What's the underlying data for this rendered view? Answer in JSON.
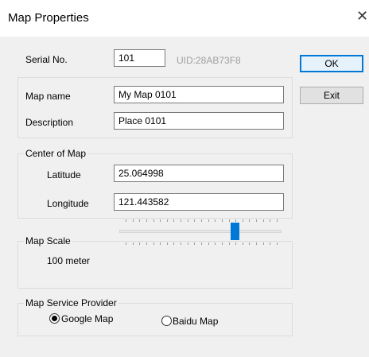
{
  "window": {
    "title": "Map Properties",
    "close_glyph": "✕"
  },
  "serial": {
    "label": "Serial No.",
    "value": "101",
    "uid": "UID:28AB73F8"
  },
  "buttons": {
    "ok": "OK",
    "exit": "Exit"
  },
  "map_info": {
    "name_label": "Map name",
    "name_value": "My Map 0101",
    "desc_label": "Description",
    "desc_value": "Place 0101"
  },
  "center": {
    "group_label": "Center of Map",
    "lat_label": "Latitude",
    "lat_value": "25.064998",
    "lon_label": "Longitude",
    "lon_value": "121.443582"
  },
  "scale": {
    "group_label": "Map Scale",
    "value_label": "100 meter",
    "slider_fraction": 0.72
  },
  "provider": {
    "group_label": "Map Service Provider",
    "options": [
      {
        "label": "Google Map",
        "selected": true
      },
      {
        "label": "Baidu Map",
        "selected": false
      }
    ]
  },
  "colors": {
    "accent": "#0078d7",
    "background": "#f0f0f0"
  },
  "icons": {
    "close": "close-icon",
    "radio": "radio-icon"
  }
}
